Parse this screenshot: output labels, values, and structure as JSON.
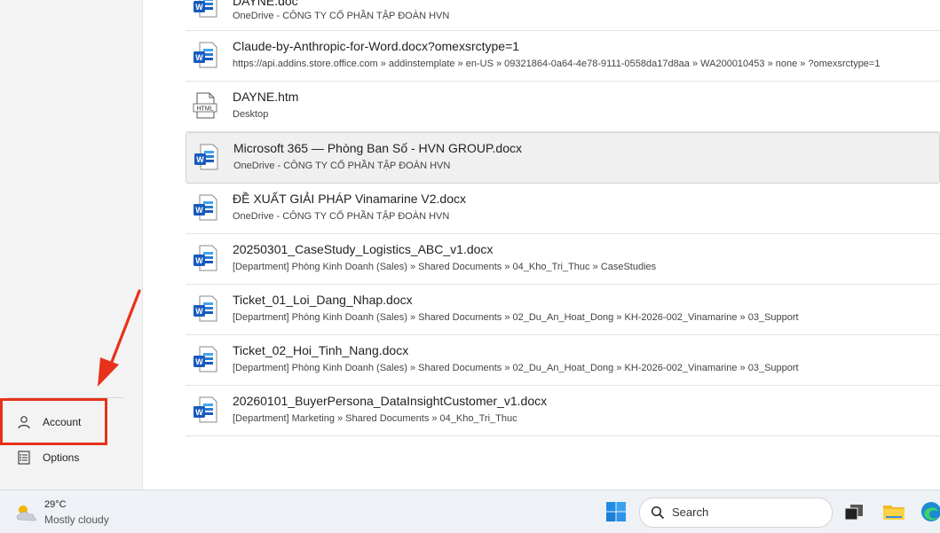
{
  "nav": {
    "account_label": "Account",
    "options_label": "Options"
  },
  "recent_files": [
    {
      "name": "DAYNE.doc",
      "path": "OneDrive - CÔNG TY CỔ PHẦN TẬP ĐOÀN HVN",
      "icon": "word-doc-icon"
    },
    {
      "name": "Claude-by-Anthropic-for-Word.docx?omexsrctype=1",
      "path": "https://api.addins.store.office.com » addinstemplate » en-US » 09321864-0a64-4e78-9111-0558da17d8aa » WA200010453 » none » ?omexsrctype=1",
      "icon": "word-doc-icon"
    },
    {
      "name": "DAYNE.htm",
      "path": "Desktop",
      "icon": "html-file-icon"
    },
    {
      "name": "Microsoft 365 — Phòng Ban Số - HVN GROUP.docx",
      "path": "OneDrive - CÔNG TY CỔ PHẦN TẬP ĐOÀN HVN",
      "icon": "word-doc-icon"
    },
    {
      "name": "ĐỀ XUẤT GIẢI PHÁP Vinamarine  V2.docx",
      "path": "OneDrive - CÔNG TY CỔ PHẦN TẬP ĐOÀN HVN",
      "icon": "word-doc-icon"
    },
    {
      "name": "20250301_CaseStudy_Logistics_ABC_v1.docx",
      "path": "[Department] Phòng Kinh Doanh (Sales) » Shared Documents » 04_Kho_Tri_Thuc » CaseStudies",
      "icon": "word-doc-icon"
    },
    {
      "name": "Ticket_01_Loi_Dang_Nhap.docx",
      "path": "[Department] Phòng Kinh Doanh (Sales) » Shared Documents » 02_Du_An_Hoat_Dong » KH-2026-002_Vinamarine » 03_Support",
      "icon": "word-doc-icon"
    },
    {
      "name": "Ticket_02_Hoi_Tinh_Nang.docx",
      "path": "[Department] Phòng Kinh Doanh (Sales) » Shared Documents » 02_Du_An_Hoat_Dong » KH-2026-002_Vinamarine » 03_Support",
      "icon": "word-doc-icon"
    },
    {
      "name": "20260101_BuyerPersona_DataInsightCustomer_v1.docx",
      "path": "[Department] Marketing » Shared Documents » 04_Kho_Tri_Thuc",
      "icon": "word-doc-icon"
    }
  ],
  "taskbar": {
    "weather_temp": "29°C",
    "weather_condition": "Mostly cloudy",
    "search_label": "Search"
  },
  "colors": {
    "annotation": "#e8311a",
    "word_blue": "#185abd"
  }
}
